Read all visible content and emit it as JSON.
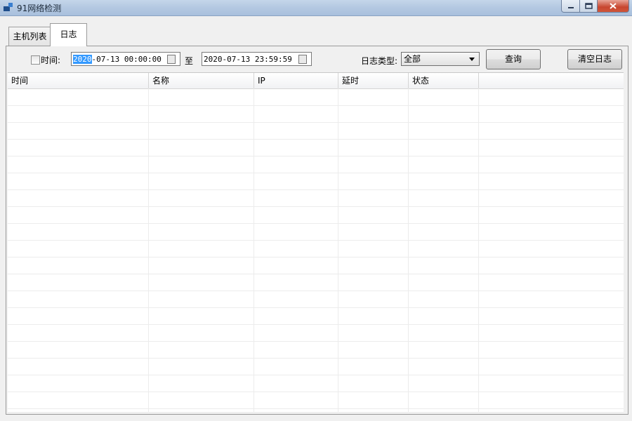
{
  "window": {
    "title": "91网络检测"
  },
  "titlebar_ghost": [
    "",
    ""
  ],
  "tabs": [
    {
      "label": "主机列表",
      "active": false
    },
    {
      "label": "日志",
      "active": true
    }
  ],
  "filter": {
    "time_checkbox_checked": false,
    "time_label": "时间:",
    "start_selected": "2020",
    "start_rest": "-07-13 00:00:00",
    "to_label": "至",
    "end_value": "2020-07-13 23:59:59",
    "log_type_label": "日志类型:",
    "log_type_value": "全部",
    "query_button": "查询",
    "clear_button": "清空日志"
  },
  "table": {
    "columns": [
      "时间",
      "名称",
      "IP",
      "延时",
      "状态"
    ],
    "rows": []
  }
}
